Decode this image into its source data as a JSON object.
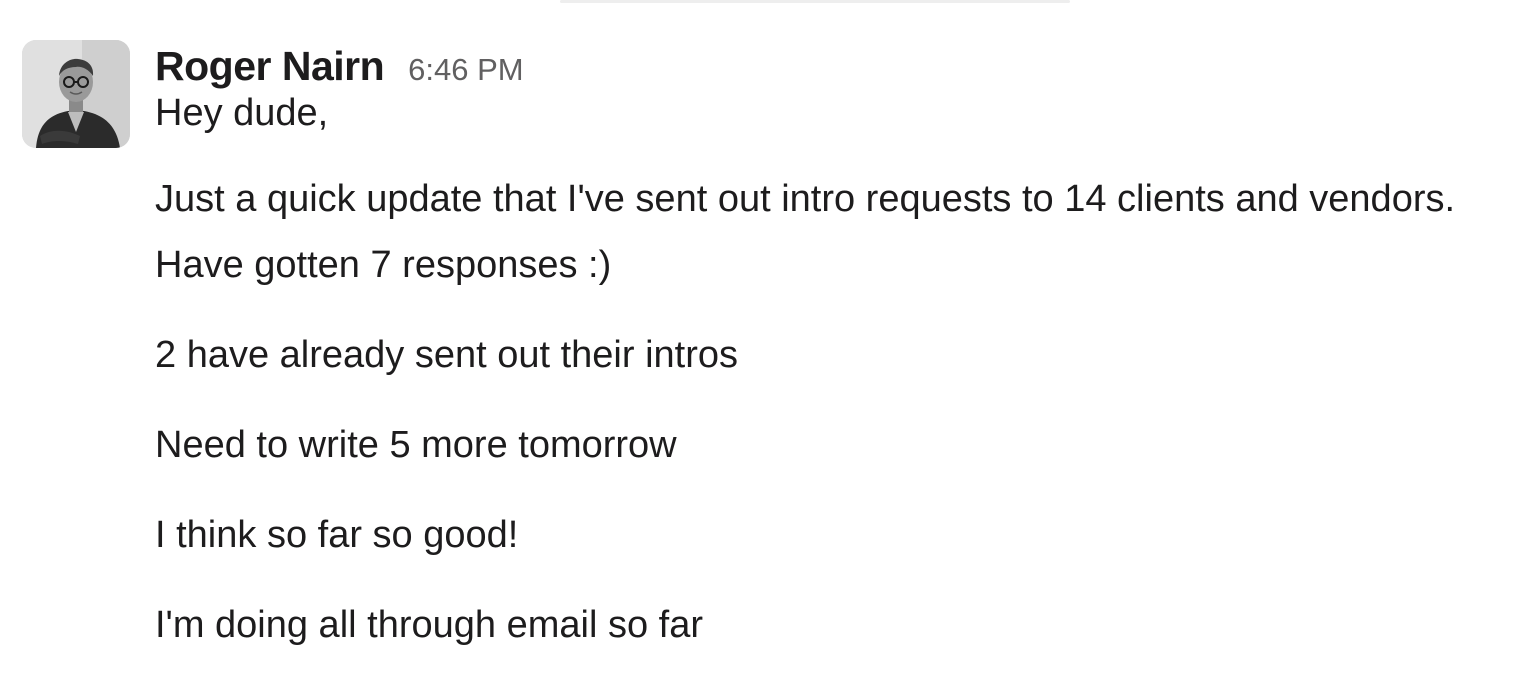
{
  "message": {
    "sender": {
      "name": "Roger Nairn",
      "avatar_icon": "user-avatar-photo"
    },
    "timestamp": "6:46 PM",
    "paragraphs": [
      "Hey dude,",
      "Just a quick update that I've sent out intro requests to 14 clients and vendors. Have gotten 7 responses :)",
      "2 have already sent out their intros",
      "Need to write 5 more tomorrow",
      "I think so far so good!",
      "I'm doing all through email so far"
    ]
  }
}
